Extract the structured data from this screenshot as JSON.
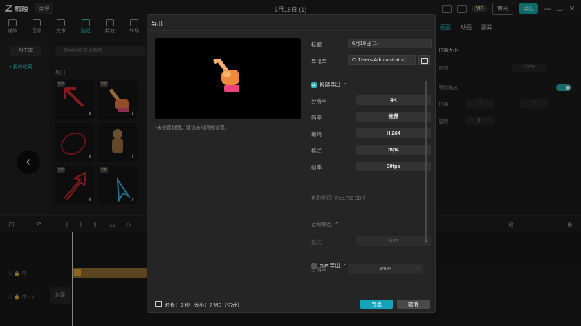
{
  "app": {
    "name": "剪映",
    "menu": "菜单",
    "window_title": "6月18日 (1)",
    "vip_badge": "VIP",
    "review_btn": "审阅",
    "export_btn": "导出",
    "minimize": "—",
    "maximize": "☐",
    "close": "✕"
  },
  "tools": [
    {
      "label": "媒体",
      "active": false
    },
    {
      "label": "音频",
      "active": false
    },
    {
      "label": "文本",
      "active": false
    },
    {
      "label": "贴纸",
      "active": true
    },
    {
      "label": "特效",
      "active": false
    },
    {
      "label": "转场",
      "active": false
    }
  ],
  "left_panel": {
    "ai_gen": "AI生成",
    "favorites": "• 我的收藏",
    "search_placeholder": "搜索贴纸或表情包",
    "hot_label": "热门",
    "vip_tag": "VIP",
    "download_icon": "download-icon",
    "prev_arrow": "‹"
  },
  "right_panel": {
    "tabs": [
      "画面",
      "动画",
      "跟踪"
    ],
    "active_tab": "画面",
    "size_label": "位置大小",
    "scale_label": "缩放",
    "scale_value": "100%",
    "lock_ratio_label": "等比缩放",
    "pos_label": "位置",
    "pos_x": "0",
    "pos_y": "0",
    "rotate_label": "旋转",
    "rotate_value": "0°"
  },
  "export_dialog": {
    "title": "导出",
    "cover_tip": "*未设置封面，建议去时间线设置。",
    "title_label": "标题",
    "title_value": "6月18日 (1)",
    "export_to_label": "导出至",
    "export_to_value": "C:/Users/Administrator/...",
    "video_section": "视频导出",
    "video_enabled": true,
    "options": [
      {
        "label": "分辨率",
        "value": "4K"
      },
      {
        "label": "码率",
        "value": "推荐"
      },
      {
        "label": "编码",
        "value": "H.264"
      },
      {
        "label": "格式",
        "value": "mp4"
      },
      {
        "label": "帧率",
        "value": "30fps"
      }
    ],
    "color_space": "色彩空间：Rec.709 SDR",
    "audio_section": "音频导出",
    "audio_format_label": "格式",
    "audio_format_value": "MP3",
    "gif_section": "GIF 导出",
    "gif_enabled": false,
    "gif_res_label": "分辨率",
    "gif_res_value": "240P",
    "footer_info": "时长：3 秒 | 大小：7 MB（估计）",
    "export_button": "导出",
    "cancel_button": "取消"
  },
  "timeline": {
    "cover_label": "封面",
    "ruler_start": "00:00",
    "ruler_end": "00:00"
  },
  "colors": {
    "accent": "#14a3b8",
    "accent_teal": "#29c6c6",
    "dialog_bg": "#252525",
    "clip_color": "#8a6a2e"
  }
}
